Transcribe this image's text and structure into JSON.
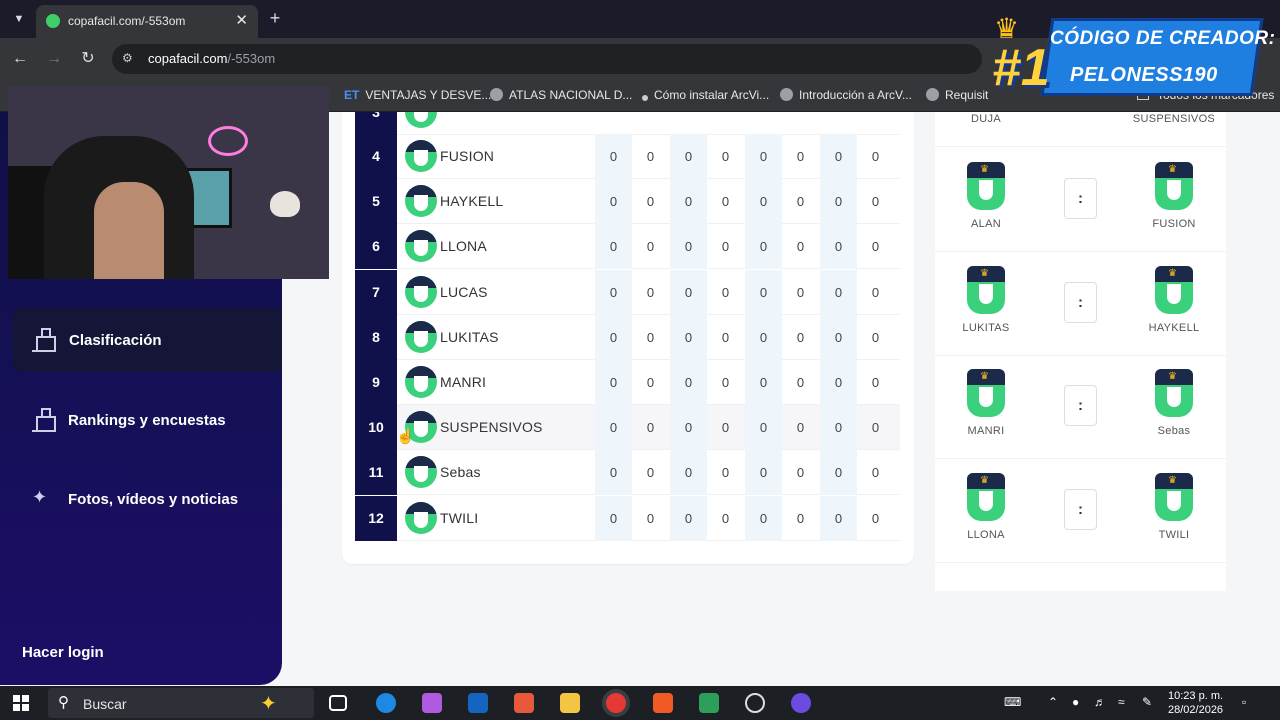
{
  "browser": {
    "tab_title": "copafacil.com/-553om",
    "url_host": "copafacil.com",
    "url_path": "/-553om",
    "bookmarks": [
      "VENTAJAS Y DESVE...",
      "ATLAS NACIONAL D...",
      "Cómo instalar ArcVi...",
      "Introducción a ArcV...",
      "Requisit",
      "Todos los marcadores"
    ]
  },
  "banner": {
    "number": "#1",
    "line1": "CÓDIGO DE CREADOR:",
    "line2": "PELONESS190"
  },
  "sidebar": {
    "items": [
      {
        "label": "Clasificación",
        "icon": "podium-icon",
        "active": true
      },
      {
        "label": "Rankings y encuestas",
        "icon": "podium-icon",
        "active": false
      },
      {
        "label": "Fotos, vídeos y noticias",
        "icon": "media-icon",
        "active": false
      }
    ],
    "login_label": "Hacer login"
  },
  "standings": {
    "rows": [
      {
        "pos": "4",
        "team": "FUSION",
        "stats": [
          "0",
          "0",
          "0",
          "0",
          "0",
          "0",
          "0",
          "0"
        ]
      },
      {
        "pos": "5",
        "team": "HAYKELL",
        "stats": [
          "0",
          "0",
          "0",
          "0",
          "0",
          "0",
          "0",
          "0"
        ]
      },
      {
        "pos": "6",
        "team": "LLONA",
        "stats": [
          "0",
          "0",
          "0",
          "0",
          "0",
          "0",
          "0",
          "0"
        ]
      },
      {
        "pos": "7",
        "team": "LUCAS",
        "stats": [
          "0",
          "0",
          "0",
          "0",
          "0",
          "0",
          "0",
          "0"
        ]
      },
      {
        "pos": "8",
        "team": "LUKITAS",
        "stats": [
          "0",
          "0",
          "0",
          "0",
          "0",
          "0",
          "0",
          "0"
        ]
      },
      {
        "pos": "9",
        "team": "MANRI",
        "stats": [
          "0",
          "0",
          "0",
          "0",
          "0",
          "0",
          "0",
          "0"
        ]
      },
      {
        "pos": "10",
        "team": "SUSPENSIVOS",
        "stats": [
          "0",
          "0",
          "0",
          "0",
          "0",
          "0",
          "0",
          "0"
        ]
      },
      {
        "pos": "11",
        "team": "Sebas",
        "stats": [
          "0",
          "0",
          "0",
          "0",
          "0",
          "0",
          "0",
          "0"
        ]
      },
      {
        "pos": "12",
        "team": "TWILI",
        "stats": [
          "0",
          "0",
          "0",
          "0",
          "0",
          "0",
          "0",
          "0"
        ]
      }
    ]
  },
  "matches": {
    "top_partial": {
      "home": "DUJA",
      "away": "SUSPENSIVOS"
    },
    "list": [
      {
        "home": "ALAN",
        "away": "FUSION",
        "score": ":"
      },
      {
        "home": "LUKITAS",
        "away": "HAYKELL",
        "score": ":"
      },
      {
        "home": "MANRI",
        "away": "Sebas",
        "score": ":"
      },
      {
        "home": "LLONA",
        "away": "TWILI",
        "score": ":"
      }
    ]
  },
  "taskbar": {
    "search_placeholder": "Buscar",
    "time": "10:23 p. m.",
    "date": "28/02/2026"
  }
}
